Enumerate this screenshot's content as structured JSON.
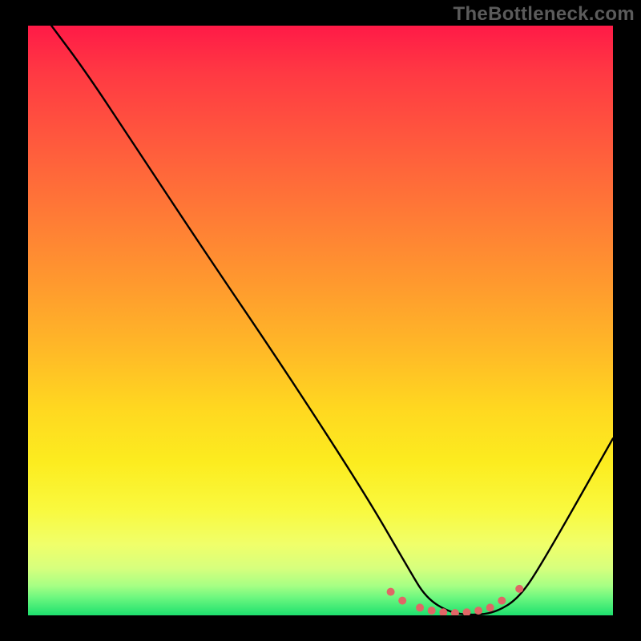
{
  "watermark": "TheBottleneck.com",
  "chart_data": {
    "type": "line",
    "title": "",
    "xlabel": "",
    "ylabel": "",
    "xlim": [
      0,
      100
    ],
    "ylim": [
      0,
      100
    ],
    "series": [
      {
        "name": "bottleneck-curve",
        "x": [
          4,
          10,
          18,
          30,
          45,
          58,
          65,
          68,
          72,
          76,
          80,
          84,
          88,
          100
        ],
        "y": [
          100,
          92,
          80,
          62,
          40,
          20,
          8,
          3,
          0.5,
          0,
          0.5,
          3,
          9,
          30
        ]
      }
    ],
    "highlight": {
      "name": "optimal-range-dots",
      "x": [
        62,
        64,
        67,
        69,
        71,
        73,
        75,
        77,
        79,
        81,
        84
      ],
      "y": [
        4,
        2.5,
        1.3,
        0.8,
        0.5,
        0.4,
        0.5,
        0.8,
        1.3,
        2.5,
        4.5
      ]
    },
    "gradient_stops": [
      {
        "pos": 0,
        "color": "#ff1a47"
      },
      {
        "pos": 8,
        "color": "#ff3943"
      },
      {
        "pos": 20,
        "color": "#ff5a3d"
      },
      {
        "pos": 32,
        "color": "#ff7a36"
      },
      {
        "pos": 44,
        "color": "#ff9a2e"
      },
      {
        "pos": 55,
        "color": "#ffb927"
      },
      {
        "pos": 65,
        "color": "#ffd820"
      },
      {
        "pos": 74,
        "color": "#fcec1f"
      },
      {
        "pos": 82,
        "color": "#f9f93e"
      },
      {
        "pos": 88,
        "color": "#f0ff6a"
      },
      {
        "pos": 92,
        "color": "#d7ff7d"
      },
      {
        "pos": 95,
        "color": "#a6ff84"
      },
      {
        "pos": 97,
        "color": "#6cf77f"
      },
      {
        "pos": 100,
        "color": "#1ee06e"
      }
    ],
    "colors": {
      "curve": "#000000",
      "dots": "#e06666",
      "background_frame": "#000000"
    }
  }
}
